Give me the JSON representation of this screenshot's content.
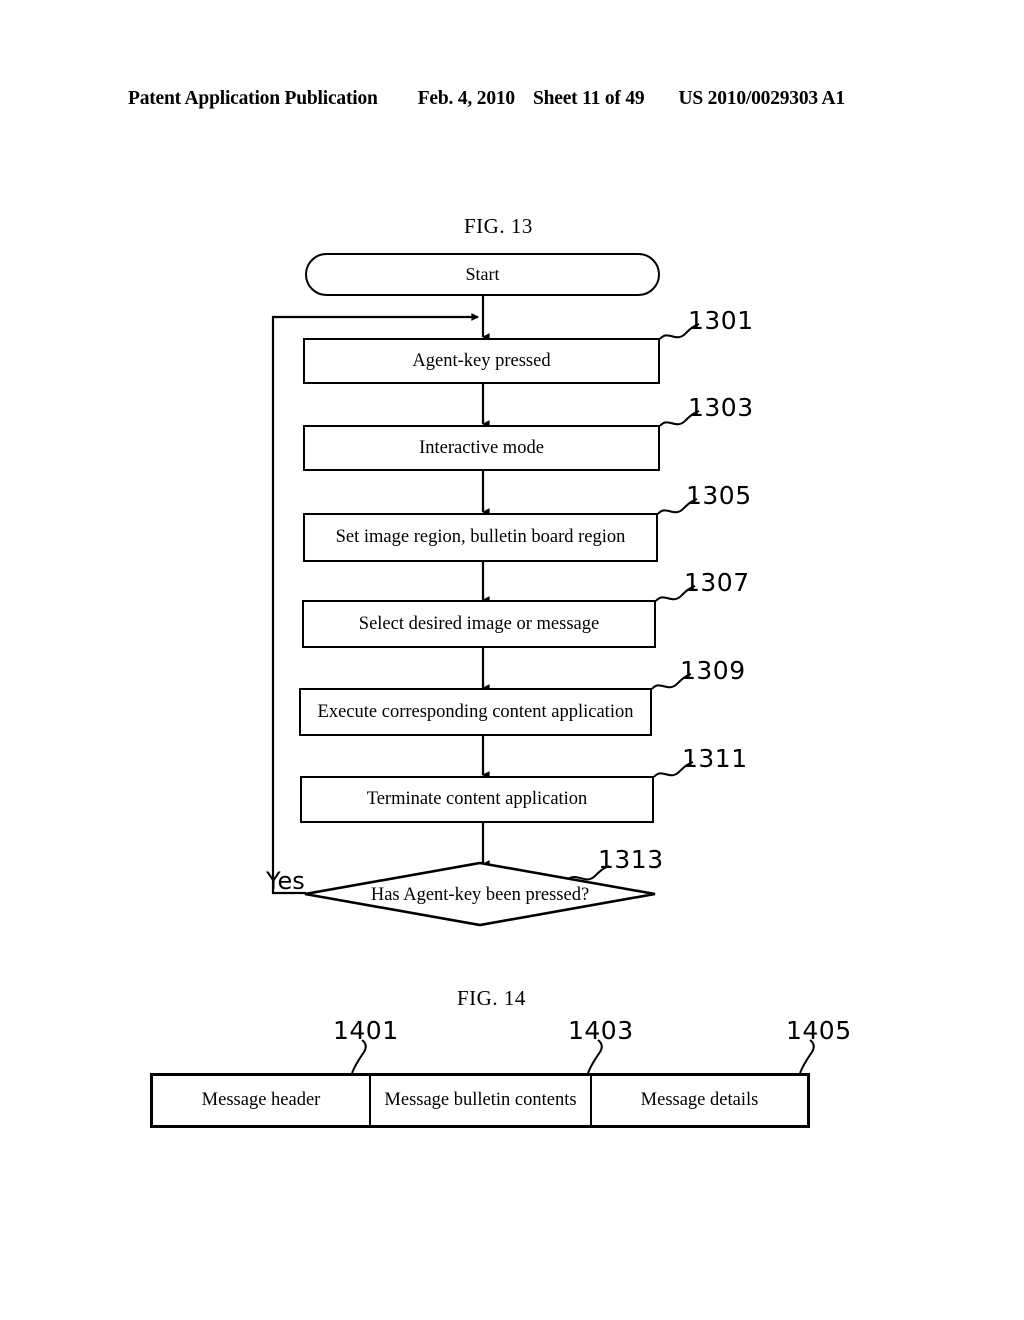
{
  "header": {
    "publication": "Patent Application Publication",
    "date": "Feb. 4, 2010",
    "sheet": "Sheet 11 of 49",
    "number": "US 2010/0029303 A1"
  },
  "fig13": {
    "caption": "FIG. 13",
    "start_label": "Start",
    "steps": [
      {
        "ref": "1301",
        "label": "Agent-key pressed"
      },
      {
        "ref": "1303",
        "label": "Interactive mode"
      },
      {
        "ref": "1305",
        "label": "Set image region, bulletin board region"
      },
      {
        "ref": "1307",
        "label": "Select desired image or message"
      },
      {
        "ref": "1309",
        "label": "Execute corresponding content application"
      },
      {
        "ref": "1311",
        "label": "Terminate content application"
      }
    ],
    "decision": {
      "ref": "1313",
      "label": "Has Agent-key been pressed?",
      "yes_label": "Yes"
    }
  },
  "fig14": {
    "caption": "FIG. 14",
    "cells": [
      {
        "ref": "1401",
        "label": "Message header"
      },
      {
        "ref": "1403",
        "label": "Message bulletin contents"
      },
      {
        "ref": "1405",
        "label": "Message details"
      }
    ]
  },
  "colors": {
    "ink": "#000000",
    "paper": "#ffffff"
  }
}
